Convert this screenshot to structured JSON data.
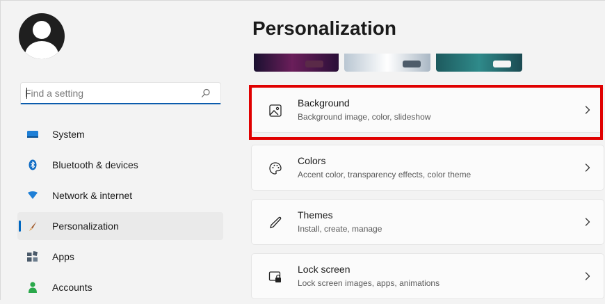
{
  "sidebar": {
    "search": {
      "value": "",
      "placeholder": "Find a setting"
    },
    "items": [
      {
        "label": "System",
        "icon": "monitor-icon",
        "active": false
      },
      {
        "label": "Bluetooth & devices",
        "icon": "bluetooth-icon",
        "active": false
      },
      {
        "label": "Network & internet",
        "icon": "wifi-icon",
        "active": false
      },
      {
        "label": "Personalization",
        "icon": "brush-icon",
        "active": true
      },
      {
        "label": "Apps",
        "icon": "apps-icon",
        "active": false
      },
      {
        "label": "Accounts",
        "icon": "person-icon",
        "active": false
      }
    ]
  },
  "main": {
    "title": "Personalization",
    "cards": [
      {
        "title": "Background",
        "description": "Background image, color, slideshow",
        "icon": "picture-icon",
        "highlighted": true
      },
      {
        "title": "Colors",
        "description": "Accent color, transparency effects, color theme",
        "icon": "palette-icon",
        "highlighted": false
      },
      {
        "title": "Themes",
        "description": "Install, create, manage",
        "icon": "pen-icon",
        "highlighted": false
      },
      {
        "title": "Lock screen",
        "description": "Lock screen images, apps, animations",
        "icon": "lock-screen-icon",
        "highlighted": false
      }
    ]
  },
  "colors": {
    "accent": "#0067c0",
    "highlight_border": "#e00000",
    "search_underline": "#0b5cad"
  }
}
